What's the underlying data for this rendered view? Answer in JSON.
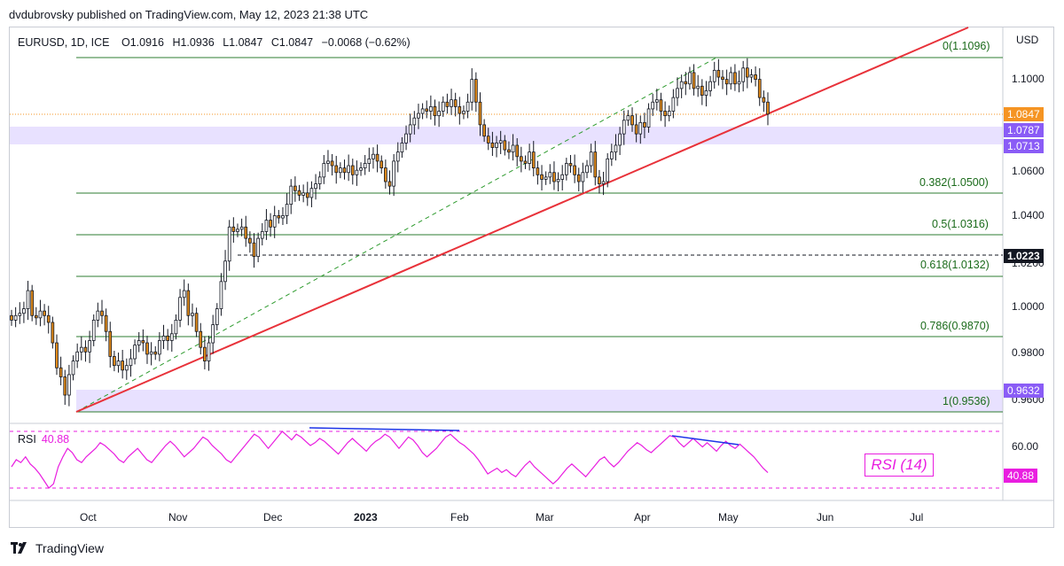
{
  "header": {
    "publisher_text": "dvdubrovsky published on TradingView.com, May 12, 2023 21:38 UTC"
  },
  "legend": {
    "symbol": "EURUSD, 1D, ICE",
    "open": "O1.0916",
    "high": "H1.0936",
    "low": "L1.0847",
    "close": "C1.0847",
    "change": "−0.0068 (−0.62%)"
  },
  "axis": {
    "currency": "USD"
  },
  "price_tags": {
    "last": "1.0847",
    "zone_top": "1.0787",
    "zone_bottom": "1.0713",
    "support": "1.0223",
    "low_zone": "0.9632",
    "rsi": "40.88"
  },
  "rsi_panel": {
    "label": "RSI",
    "value": "40.88",
    "badge": "RSI (14)"
  },
  "footer": {
    "brand": "TradingView"
  },
  "colors": {
    "up": "#ffffff",
    "down": "#e08a1a",
    "wick": "#131722",
    "trendline": "#e8323a",
    "fib": "#1b6b1b",
    "zone": "#d6ccff",
    "rsi": "#e91ee0",
    "divergence": "#1c33e8",
    "last_price": "#f59423",
    "zone_tag": "#8a5cf6",
    "dark_tag": "#131722"
  },
  "chart_data": {
    "type": "candlestick",
    "symbol": "EURUSD",
    "timeframe": "1D",
    "x_tick_labels": [
      "Oct",
      "Nov",
      "Dec",
      "2023",
      "Feb",
      "Mar",
      "Apr",
      "May",
      "Jun",
      "Jul"
    ],
    "y_tick_labels": [
      "1.1000",
      "1.0600",
      "1.0400",
      "1.0200",
      "1.0000",
      "0.9800",
      "0.9600"
    ],
    "ylim": [
      0.95,
      1.12
    ],
    "fib_levels": [
      {
        "label": "0(1.1096)",
        "value": 1.1096
      },
      {
        "label": "0.382(1.0500)",
        "value": 1.05
      },
      {
        "label": "0.5(1.0316)",
        "value": 1.0316
      },
      {
        "label": "0.618(1.0132)",
        "value": 1.0132
      },
      {
        "label": "0.786(0.9870)",
        "value": 0.987
      },
      {
        "label": "1(0.9536)",
        "value": 0.9536
      }
    ],
    "zones": [
      {
        "top": 1.0787,
        "bottom": 1.0713
      },
      {
        "top": 0.9632,
        "bottom": 0.9536
      }
    ],
    "horizontal_lines": [
      {
        "value": 1.0847,
        "style": "dotted",
        "color": "#f59423"
      },
      {
        "value": 1.0223,
        "style": "dashed",
        "color": "#131722"
      }
    ],
    "trendline": {
      "from": {
        "date": "2022-09-28",
        "price": 0.9536
      },
      "to": {
        "date": "2023-07-31",
        "price": 1.133
      }
    },
    "fib_diagonal": {
      "from": {
        "date": "2022-09-28",
        "price": 0.9536
      },
      "to": {
        "date": "2023-04-28",
        "price": 1.1096
      }
    },
    "closes": [
      0.994,
      0.996,
      0.997,
      0.999,
      1.007,
      0.996,
      0.995,
      0.998,
      0.996,
      0.993,
      0.984,
      0.973,
      0.969,
      0.961,
      0.97,
      0.976,
      0.98,
      0.982,
      0.98,
      0.985,
      0.994,
      0.998,
      0.996,
      0.989,
      0.978,
      0.974,
      0.976,
      0.972,
      0.974,
      0.977,
      0.983,
      0.985,
      0.984,
      0.979,
      0.98,
      0.979,
      0.985,
      0.987,
      0.985,
      0.988,
      0.994,
      1.004,
      1.007,
      0.996,
      0.997,
      0.989,
      0.982,
      0.976,
      0.984,
      0.992,
      0.999,
      1.011,
      1.02,
      1.035,
      1.033,
      1.034,
      1.035,
      1.03,
      1.028,
      1.022,
      1.03,
      1.033,
      1.038,
      1.035,
      1.04,
      1.039,
      1.04,
      1.045,
      1.053,
      1.051,
      1.049,
      1.05,
      1.048,
      1.052,
      1.054,
      1.057,
      1.063,
      1.064,
      1.062,
      1.059,
      1.061,
      1.059,
      1.062,
      1.058,
      1.06,
      1.061,
      1.063,
      1.065,
      1.067,
      1.064,
      1.061,
      1.055,
      1.053,
      1.064,
      1.068,
      1.072,
      1.076,
      1.08,
      1.083,
      1.085,
      1.087,
      1.086,
      1.088,
      1.084,
      1.086,
      1.09,
      1.088,
      1.091,
      1.088,
      1.085,
      1.086,
      1.09,
      1.1,
      1.09,
      1.08,
      1.075,
      1.072,
      1.07,
      1.072,
      1.073,
      1.069,
      1.068,
      1.071,
      1.066,
      1.064,
      1.063,
      1.068,
      1.061,
      1.058,
      1.056,
      1.057,
      1.059,
      1.055,
      1.056,
      1.058,
      1.063,
      1.062,
      1.058,
      1.055,
      1.059,
      1.062,
      1.068,
      1.057,
      1.054,
      1.055,
      1.065,
      1.068,
      1.071,
      1.076,
      1.082,
      1.084,
      1.08,
      1.076,
      1.081,
      1.079,
      1.087,
      1.09,
      1.091,
      1.086,
      1.084,
      1.086,
      1.092,
      1.096,
      1.099,
      1.098,
      1.103,
      1.096,
      1.097,
      1.093,
      1.095,
      1.099,
      1.104,
      1.101,
      1.1,
      1.098,
      1.103,
      1.098,
      1.099,
      1.105,
      1.101,
      1.102,
      1.1,
      1.092,
      1.09,
      1.0847
    ],
    "rsi": {
      "period": 14,
      "current": 40.88,
      "levels": [
        70,
        30
      ],
      "y_tick_labels": [
        "60.00"
      ],
      "values": [
        45,
        50,
        48,
        52,
        47,
        44,
        40,
        35,
        30,
        33,
        45,
        52,
        58,
        55,
        50,
        48,
        52,
        55,
        58,
        62,
        60,
        57,
        54,
        50,
        48,
        52,
        55,
        58,
        54,
        50,
        48,
        52,
        56,
        60,
        63,
        60,
        56,
        52,
        55,
        58,
        62,
        66,
        64,
        60,
        57,
        54,
        50,
        48,
        52,
        56,
        60,
        64,
        68,
        66,
        62,
        58,
        62,
        66,
        70,
        67,
        64,
        68,
        66,
        63,
        60,
        62,
        65,
        63,
        60,
        57,
        54,
        58,
        62,
        65,
        62,
        59,
        56,
        60,
        63,
        65,
        68,
        66,
        62,
        58,
        62,
        66,
        64,
        60,
        55,
        52,
        55,
        58,
        62,
        66,
        68,
        65,
        62,
        60,
        57,
        54,
        50,
        45,
        40,
        42,
        44,
        41,
        43,
        40,
        38,
        42,
        46,
        49,
        45,
        42,
        39,
        36,
        33,
        36,
        40,
        44,
        47,
        44,
        41,
        38,
        42,
        46,
        50,
        52,
        48,
        45,
        48,
        52,
        56,
        59,
        62,
        60,
        57,
        55,
        58,
        61,
        64,
        67,
        66,
        62,
        59,
        62,
        65,
        62,
        59,
        62,
        59,
        56,
        60,
        63,
        60,
        58,
        61,
        58,
        55,
        52,
        48,
        44,
        40.88
      ]
    },
    "divergences": [
      {
        "panel": "rsi",
        "from": {
          "date": "2022-12-15",
          "value": 70
        },
        "to": {
          "date": "2023-01-30",
          "value": 69
        }
      },
      {
        "panel": "rsi",
        "from": {
          "date": "2023-04-13",
          "value": 68
        },
        "to": {
          "date": "2023-05-04",
          "value": 63
        }
      }
    ]
  }
}
